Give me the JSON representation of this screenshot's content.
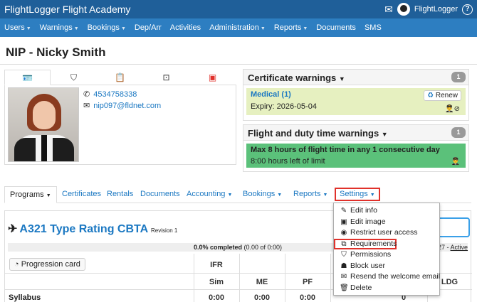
{
  "topbar": {
    "brand": "FlightLogger Flight Academy",
    "user": "FlightLogger",
    "help": "?"
  },
  "nav": [
    {
      "label": "Users",
      "dropdown": true
    },
    {
      "label": "Warnings",
      "dropdown": true
    },
    {
      "label": "Bookings",
      "dropdown": true
    },
    {
      "label": "Dep/Arr",
      "dropdown": false
    },
    {
      "label": "Activities",
      "dropdown": false
    },
    {
      "label": "Administration",
      "dropdown": true
    },
    {
      "label": "Reports",
      "dropdown": true
    },
    {
      "label": "Documents",
      "dropdown": false
    },
    {
      "label": "SMS",
      "dropdown": false
    }
  ],
  "page_title": "NIP - Nicky Smith",
  "profile": {
    "phone": "4534758338",
    "email": "nip097@fldnet.com"
  },
  "cert_warnings": {
    "title": "Certificate warnings",
    "count": "1",
    "item_name": "Medical (1)",
    "expiry": "Expiry: 2026-05-04",
    "renew": "Renew"
  },
  "flight_warnings": {
    "title": "Flight and duty time warnings",
    "count": "1",
    "limit_title": "Max 8 hours of flight time in any 1 consecutive day",
    "limit_sub": "8:00 hours left of limit"
  },
  "tabs": {
    "programs": "Programs",
    "certificates": "Certificates",
    "rentals": "Rentals",
    "documents": "Documents",
    "accounting": "Accounting",
    "bookings": "Bookings",
    "reports": "Reports",
    "settings": "Settings"
  },
  "program": {
    "title": "A321 Type Rating CBTA",
    "revision": "Revision 1",
    "progress_text": "0.0% completed",
    "progress_detail": "(0.00 of 0:00)",
    "progress_fraction": 0,
    "status_date": "27",
    "status_sep": "-",
    "status_link": "Active",
    "progression_card": "Progression card"
  },
  "grid": {
    "ifr": "IFR",
    "cols": [
      "Sim",
      "ME",
      "PF",
      "LDG"
    ],
    "syllabus_label": "Syllabus",
    "syllabus_values": [
      "0:00",
      "0:00",
      "0:00",
      "0"
    ]
  },
  "settings_menu": [
    {
      "label": "Edit info",
      "icon": "pencil-icon"
    },
    {
      "label": "Edit image",
      "icon": "image-icon"
    },
    {
      "label": "Restrict user access",
      "icon": "eye-icon"
    },
    {
      "label": "Requirements",
      "icon": "copy-icon"
    },
    {
      "label": "Permissions",
      "icon": "shield-icon"
    },
    {
      "label": "Block user",
      "icon": "user-lock-icon"
    },
    {
      "label": "Resend the welcome email",
      "icon": "envelope-icon"
    },
    {
      "label": "Delete",
      "icon": "trash-icon"
    }
  ],
  "colors": {
    "topbar": "#1f5f99",
    "navbar": "#2d7ec1",
    "link": "#1b78c2",
    "highlight": "#e0312b",
    "cert_bg": "#e6f0c0",
    "limit_bg": "#5bc17a"
  }
}
